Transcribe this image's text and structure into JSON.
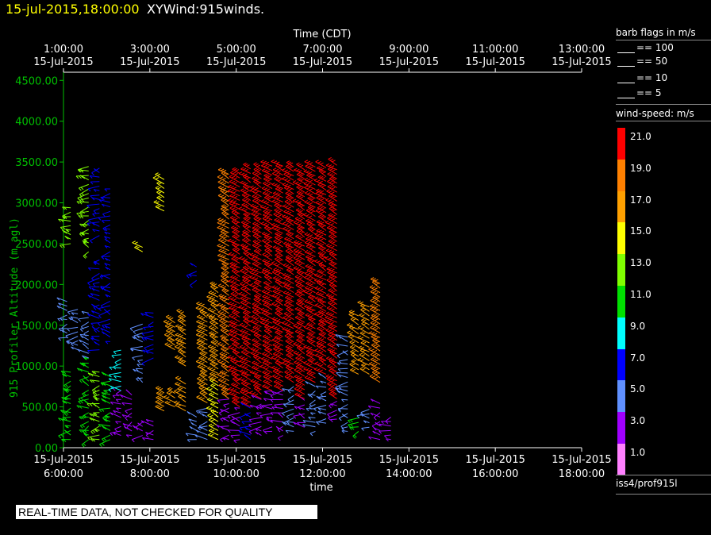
{
  "header": {
    "datetime": "15-jul-2015,18:00:00",
    "product": "XYWind:915winds."
  },
  "colors": {
    "background": "#000000",
    "axis_left": "#00c000",
    "axis": "#ffffff",
    "date_text": "#ffff00"
  },
  "top_axis": {
    "title": "Time (CDT)",
    "ticks": [
      {
        "time": "1:00:00",
        "date": "15-Jul-2015"
      },
      {
        "time": "3:00:00",
        "date": "15-Jul-2015"
      },
      {
        "time": "5:00:00",
        "date": "15-Jul-2015"
      },
      {
        "time": "7:00:00",
        "date": "15-Jul-2015"
      },
      {
        "time": "9:00:00",
        "date": "15-Jul-2015"
      },
      {
        "time": "11:00:00",
        "date": "15-Jul-2015"
      },
      {
        "time": "13:00:00",
        "date": "15-Jul-2015"
      }
    ]
  },
  "bottom_axis": {
    "title": "time",
    "ticks": [
      {
        "date": "15-Jul-2015",
        "time": "6:00:00"
      },
      {
        "date": "15-Jul-2015",
        "time": "8:00:00"
      },
      {
        "date": "15-Jul-2015",
        "time": "10:00:00"
      },
      {
        "date": "15-Jul-2015",
        "time": "12:00:00"
      },
      {
        "date": "15-Jul-2015",
        "time": "14:00:00"
      },
      {
        "date": "15-Jul-2015",
        "time": "16:00:00"
      },
      {
        "date": "15-Jul-2015",
        "time": "18:00:00"
      }
    ]
  },
  "barb_legend": {
    "title": "barb flags in m/s",
    "items": [
      "== 100",
      "== 50",
      "== 10",
      "== 5"
    ]
  },
  "speed_legend": {
    "title": "wind-speed: m/s",
    "bins": [
      {
        "label": "21.0",
        "color": "#ff0000"
      },
      {
        "label": "19.0",
        "color": "#ff8000"
      },
      {
        "label": "17.0",
        "color": "#ffa000"
      },
      {
        "label": "15.0",
        "color": "#ffff00"
      },
      {
        "label": "13.0",
        "color": "#80ff00"
      },
      {
        "label": "11.0",
        "color": "#00e000"
      },
      {
        "label": "9.0",
        "color": "#00ffff"
      },
      {
        "label": "7.0",
        "color": "#0000ff"
      },
      {
        "label": "5.0",
        "color": "#6090ff"
      },
      {
        "label": "3.0",
        "color": "#a000ff"
      },
      {
        "label": "1.0",
        "color": "#ff80ff"
      }
    ]
  },
  "dataset_label": "iss4/prof915l",
  "qc_notice": "REAL-TIME DATA, NOT CHECKED FOR QUALITY",
  "chart_data": {
    "type": "scatter",
    "title": "",
    "xlabel": "time",
    "x2label": "Time (CDT)",
    "ylabel": "915 Profiler Altitude (m agl)",
    "xlim": [
      "15-Jul-2015 6:00:00",
      "15-Jul-2015 18:00:00"
    ],
    "ylim": [
      0,
      4600
    ],
    "yticks": [
      "0.00",
      "500.00",
      "1000.00",
      "1500.00",
      "2000.00",
      "2500.00",
      "3000.00",
      "3500.00",
      "4000.00",
      "4500.00"
    ],
    "grid": false,
    "legend": "right",
    "profile_times": [
      "06:05",
      "06:20",
      "06:35",
      "06:50",
      "07:05",
      "07:20",
      "07:35",
      "07:50",
      "08:05",
      "08:20",
      "08:35",
      "08:50",
      "09:05",
      "09:20",
      "09:35",
      "09:50",
      "10:05",
      "10:20",
      "10:35",
      "10:50",
      "11:05",
      "11:20",
      "11:35",
      "11:50",
      "12:05",
      "12:20",
      "12:35",
      "12:50",
      "13:05",
      "13:20",
      "13:35",
      "13:50",
      "14:05"
    ],
    "profiles": [
      {
        "time": "06:05",
        "alt_range": [
          1350,
          1800
        ],
        "speed": 6
      },
      {
        "time": "06:10",
        "alt_range": [
          100,
          950
        ],
        "speed": 11
      },
      {
        "time": "06:10",
        "alt_range": [
          2500,
          2950
        ],
        "speed": 14
      },
      {
        "time": "06:20",
        "alt_range": [
          1200,
          1700
        ],
        "speed": 5
      },
      {
        "time": "06:35",
        "alt_range": [
          100,
          1100
        ],
        "speed": 12
      },
      {
        "time": "06:35",
        "alt_range": [
          1100,
          1700
        ],
        "speed": 6
      },
      {
        "time": "06:35",
        "alt_range": [
          2400,
          3450
        ],
        "speed": 13
      },
      {
        "time": "06:50",
        "alt_range": [
          100,
          950
        ],
        "speed": 13
      },
      {
        "time": "06:50",
        "alt_range": [
          1200,
          2300
        ],
        "speed": 7
      },
      {
        "time": "06:50",
        "alt_range": [
          2600,
          3450
        ],
        "speed": 7
      },
      {
        "time": "07:05",
        "alt_range": [
          100,
          900
        ],
        "speed": 12
      },
      {
        "time": "07:05",
        "alt_range": [
          1300,
          3200
        ],
        "speed": 8
      },
      {
        "time": "07:20",
        "alt_range": [
          150,
          800
        ],
        "speed": 4
      },
      {
        "time": "07:20",
        "alt_range": [
          700,
          1200
        ],
        "speed": 9
      },
      {
        "time": "07:35",
        "alt_range": [
          150,
          650
        ],
        "speed": 4
      },
      {
        "time": "07:50",
        "alt_range": [
          150,
          350
        ],
        "speed": 3
      },
      {
        "time": "07:50",
        "alt_range": [
          800,
          1550
        ],
        "speed": 6
      },
      {
        "time": "07:50",
        "alt_range": [
          2400,
          2500
        ],
        "speed": 16
      },
      {
        "time": "08:05",
        "alt_range": [
          100,
          350
        ],
        "speed": 3
      },
      {
        "time": "08:05",
        "alt_range": [
          1100,
          1650
        ],
        "speed": 7
      },
      {
        "time": "08:20",
        "alt_range": [
          450,
          700
        ],
        "speed": 18
      },
      {
        "time": "08:20",
        "alt_range": [
          2900,
          3300
        ],
        "speed": 16
      },
      {
        "time": "08:35",
        "alt_range": [
          500,
          700
        ],
        "speed": 17
      },
      {
        "time": "08:35",
        "alt_range": [
          1200,
          1550
        ],
        "speed": 18
      },
      {
        "time": "08:50",
        "alt_range": [
          450,
          800
        ],
        "speed": 17
      },
      {
        "time": "08:50",
        "alt_range": [
          1000,
          1650
        ],
        "speed": 18
      },
      {
        "time": "09:05",
        "alt_range": [
          100,
          400
        ],
        "speed": 5
      },
      {
        "time": "09:05",
        "alt_range": [
          2050,
          2250
        ],
        "speed": 7
      },
      {
        "time": "09:20",
        "alt_range": [
          100,
          500
        ],
        "speed": 6
      },
      {
        "time": "09:20",
        "alt_range": [
          550,
          1750
        ],
        "speed": 18
      },
      {
        "time": "09:35",
        "alt_range": [
          100,
          800
        ],
        "speed": 15
      },
      {
        "time": "09:35",
        "alt_range": [
          800,
          2000
        ],
        "speed": 18
      },
      {
        "time": "09:50",
        "alt_range": [
          100,
          600
        ],
        "speed": 3
      },
      {
        "time": "09:50",
        "alt_range": [
          600,
          3350
        ],
        "speed": 20
      },
      {
        "time": "10:05",
        "alt_range": [
          100,
          500
        ],
        "speed": 4
      },
      {
        "time": "10:05",
        "alt_range": [
          500,
          3400
        ],
        "speed": 21
      },
      {
        "time": "10:20",
        "alt_range": [
          100,
          500
        ],
        "speed": 7
      },
      {
        "time": "10:20",
        "alt_range": [
          500,
          3450
        ],
        "speed": 21
      },
      {
        "time": "10:35",
        "alt_range": [
          150,
          600
        ],
        "speed": 3
      },
      {
        "time": "10:35",
        "alt_range": [
          600,
          3450
        ],
        "speed": 21
      },
      {
        "time": "10:50",
        "alt_range": [
          200,
          700
        ],
        "speed": 4
      },
      {
        "time": "10:50",
        "alt_range": [
          700,
          3450
        ],
        "speed": 21
      },
      {
        "time": "11:05",
        "alt_range": [
          150,
          700
        ],
        "speed": 3
      },
      {
        "time": "11:05",
        "alt_range": [
          700,
          3450
        ],
        "speed": 21
      },
      {
        "time": "11:20",
        "alt_range": [
          200,
          800
        ],
        "speed": 5
      },
      {
        "time": "11:20",
        "alt_range": [
          800,
          3450
        ],
        "speed": 21
      },
      {
        "time": "11:35",
        "alt_range": [
          250,
          600
        ],
        "speed": 4
      },
      {
        "time": "11:35",
        "alt_range": [
          600,
          3450
        ],
        "speed": 21
      },
      {
        "time": "11:50",
        "alt_range": [
          200,
          800
        ],
        "speed": 6
      },
      {
        "time": "11:50",
        "alt_range": [
          800,
          3450
        ],
        "speed": 21
      },
      {
        "time": "12:05",
        "alt_range": [
          300,
          900
        ],
        "speed": 5
      },
      {
        "time": "12:05",
        "alt_range": [
          900,
          3450
        ],
        "speed": 21
      },
      {
        "time": "12:20",
        "alt_range": [
          350,
          600
        ],
        "speed": 3
      },
      {
        "time": "12:20",
        "alt_range": [
          600,
          3500
        ],
        "speed": 21
      },
      {
        "time": "12:35",
        "alt_range": [
          200,
          1400
        ],
        "speed": 6
      },
      {
        "time": "12:50",
        "alt_range": [
          200,
          400
        ],
        "speed": 11
      },
      {
        "time": "12:50",
        "alt_range": [
          900,
          1650
        ],
        "speed": 17
      },
      {
        "time": "13:05",
        "alt_range": [
          250,
          500
        ],
        "speed": 5
      },
      {
        "time": "13:05",
        "alt_range": [
          900,
          1750
        ],
        "speed": 17
      },
      {
        "time": "13:20",
        "alt_range": [
          100,
          550
        ],
        "speed": 3
      },
      {
        "time": "13:20",
        "alt_range": [
          800,
          2050
        ],
        "speed": 19
      },
      {
        "time": "13:35",
        "alt_range": [
          100,
          400
        ],
        "speed": 4
      }
    ]
  }
}
